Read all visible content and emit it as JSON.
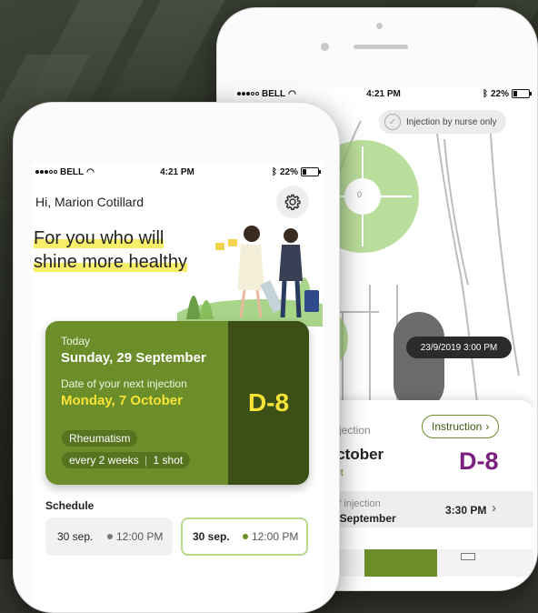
{
  "status": {
    "carrier": "BELL",
    "time": "4:21 PM",
    "battery": "22%"
  },
  "back": {
    "injection_toggle": "Injection by nurse only",
    "body_marker": "0",
    "tooltip": "23/9/2019  3:00 PM",
    "card": {
      "next_injection": "t injection",
      "instruction_label": "Instruction",
      "month": "October",
      "shot": "shot",
      "dday": "D-8",
      "date_label": "e of injection",
      "date_value": "23 September",
      "time_value": "3:30 PM"
    }
  },
  "front": {
    "greeting": "Hi, Marion Cotillard",
    "headline_line1": "For you who will",
    "headline_line2": "shine more healthy",
    "card": {
      "today_label": "Today",
      "today_date": "Sunday, 29 September",
      "next_label": "Date of your next injection",
      "next_date": "Monday, 7 October",
      "condition": "Rheumatism",
      "frequency": "every 2 weeks",
      "dose": "1 shot",
      "dday": "D-8"
    },
    "schedule": {
      "title": "Schedule",
      "items": [
        {
          "date": "30 sep.",
          "time": "12:00 PM"
        },
        {
          "date": "30 sep.",
          "time": "12:00 PM"
        }
      ]
    }
  },
  "colors": {
    "accent_green": "#6b8e2a",
    "dark_green": "#3b4f17",
    "yellow": "#f7e335",
    "purple": "#7b1f7e"
  }
}
